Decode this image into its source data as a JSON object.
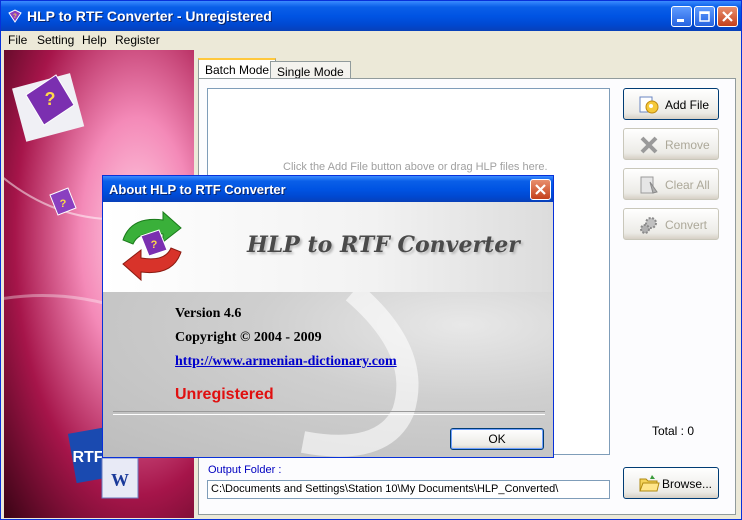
{
  "window": {
    "title": "HLP to RTF Converter - Unregistered"
  },
  "menu": [
    "File",
    "Setting",
    "Help",
    "Register"
  ],
  "tabs": [
    {
      "label": "Batch Mode",
      "active": true
    },
    {
      "label": "Single Mode",
      "active": false
    }
  ],
  "filelist": {
    "hint": "Click the Add File button above or drag HLP files here."
  },
  "buttons": {
    "add_file": "Add File",
    "remove": "Remove",
    "clear_all": "Clear All",
    "convert": "Convert",
    "browse": "Browse..."
  },
  "total": "Total : 0",
  "output": {
    "label": "Output Folder :",
    "value": "C:\\Documents and Settings\\Station 10\\My Documents\\HLP_Converted\\"
  },
  "about": {
    "title": "About HLP to RTF Converter",
    "banner": "HLP to RTF Converter",
    "version": "Version 4.6",
    "copyright": "Copyright © 2004 - 2009",
    "url": "http://www.armenian-dictionary.com",
    "status": "Unregistered",
    "ok": "OK"
  },
  "side_graphic": {
    "rtf_badge": "RTF",
    "word_badge": "W"
  },
  "colors": {
    "titlebar": "#0054e3",
    "accent_status": "#e01010",
    "link": "#0000cc",
    "tab_highlight": "#ffc83c"
  }
}
